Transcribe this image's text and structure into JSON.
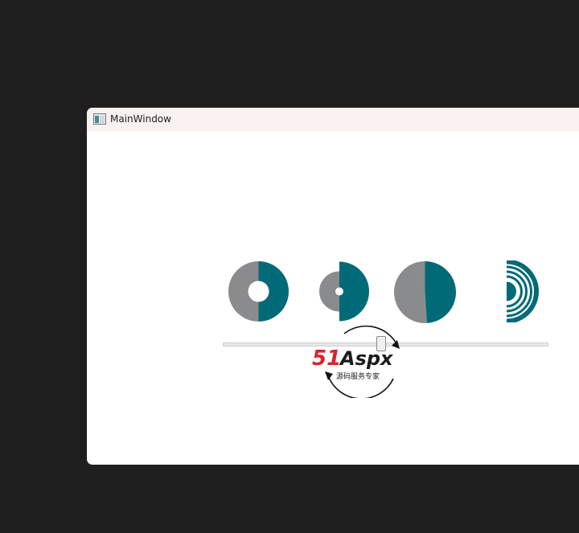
{
  "window": {
    "title": "MainWindow",
    "icon": "app-window-icon"
  },
  "pies": [
    {
      "name": "donut-pie",
      "value_percent": 50,
      "inner_hole": "large"
    },
    {
      "name": "small-donut-pie",
      "value_percent": 50,
      "inner_hole": "small"
    },
    {
      "name": "full-pie",
      "value_percent": 49,
      "inner_hole": "none"
    },
    {
      "name": "arc-rings",
      "value_percent": 50,
      "inner_hole": "rings"
    }
  ],
  "slider": {
    "value_percent": 48.6
  },
  "watermark": {
    "brand_number": "51",
    "brand_text": "Aspx",
    "tagline": "源码服务专家"
  },
  "colors": {
    "fill": "#006a77",
    "remainder": "#8a8b8d",
    "hole": "#ffffff",
    "brand_red": "#d9232e",
    "brand_green": "#2fa33a"
  }
}
